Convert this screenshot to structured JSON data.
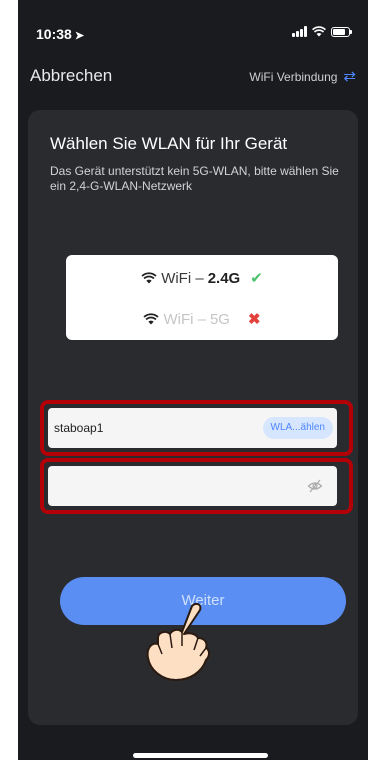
{
  "status_bar": {
    "time": "10:38"
  },
  "nav": {
    "cancel_label": "Abbrechen",
    "connection_label": "WiFi Verbindung"
  },
  "card": {
    "title": "Wählen Sie WLAN für Ihr Gerät",
    "subtitle": "Das Gerät unterstützt kein 5G-WLAN, bitte wählen Sie ein 2,4-G-WLAN-Netzwerk"
  },
  "bands": [
    {
      "prefix": "WiFi – ",
      "freq": "2.4G",
      "supported": true,
      "mark": "✔"
    },
    {
      "prefix": "WiFi – ",
      "freq": "5G",
      "supported": false,
      "mark": "✖"
    }
  ],
  "form": {
    "ssid_value": "staboap1",
    "choose_wlan_label": "WLA...ählen",
    "password_value": ""
  },
  "actions": {
    "next_label": "Weiter"
  },
  "colors": {
    "accent": "#5a8ef2",
    "highlight_frame": "#b30008",
    "check": "#4cc36b",
    "cross": "#e2413c"
  }
}
